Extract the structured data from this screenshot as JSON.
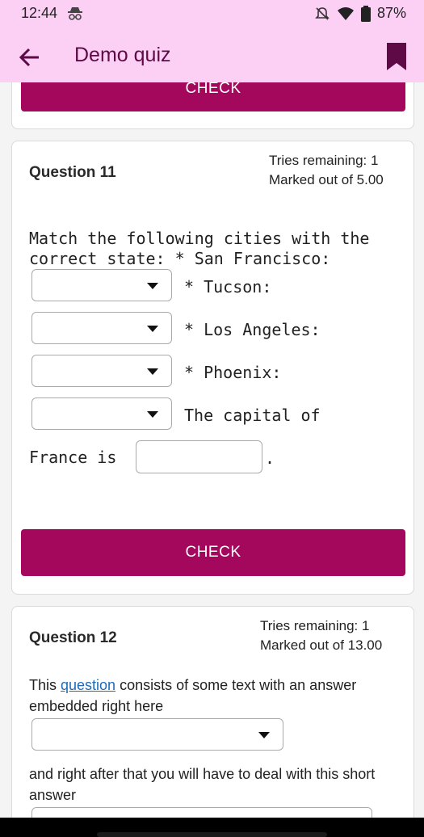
{
  "status_bar": {
    "time": "12:44",
    "battery": "87%",
    "icons": [
      "incognito-icon",
      "mute-icon",
      "wifi-icon",
      "battery-icon"
    ]
  },
  "app_bar": {
    "title": "Demo quiz",
    "back_icon": "back-arrow-icon",
    "bookmark_icon": "bookmark-icon",
    "color": "#fccff4"
  },
  "prev_card": {
    "check_label": "CHECK"
  },
  "question11": {
    "heading": "Question 11",
    "tries": "Tries remaining: 1",
    "marks": "Marked out of 5.00",
    "prompt_line1": "Match the following cities with the",
    "prompt_line2": "correct state: * San Francisco:",
    "item_tucson": "* Tucson:",
    "item_la": "* Los Angeles:",
    "item_phoenix": "* Phoenix:",
    "capital_text1": "The capital of",
    "capital_text2": "France is",
    "period": ".",
    "check_label": "CHECK"
  },
  "question12": {
    "heading": "Question 12",
    "tries": "Tries remaining: 1",
    "marks": "Marked out of 13.00",
    "text_before_link": "This ",
    "link_text": "question",
    "text_after_link": " consists of some text with an answer",
    "text_line2": "embedded right here",
    "text_after_select": "and right after that you will have to deal with this short",
    "text_after_select2": "answer"
  },
  "colors": {
    "accent": "#a3085d",
    "title_color": "#5d0a47",
    "link": "#1e6bb8"
  }
}
